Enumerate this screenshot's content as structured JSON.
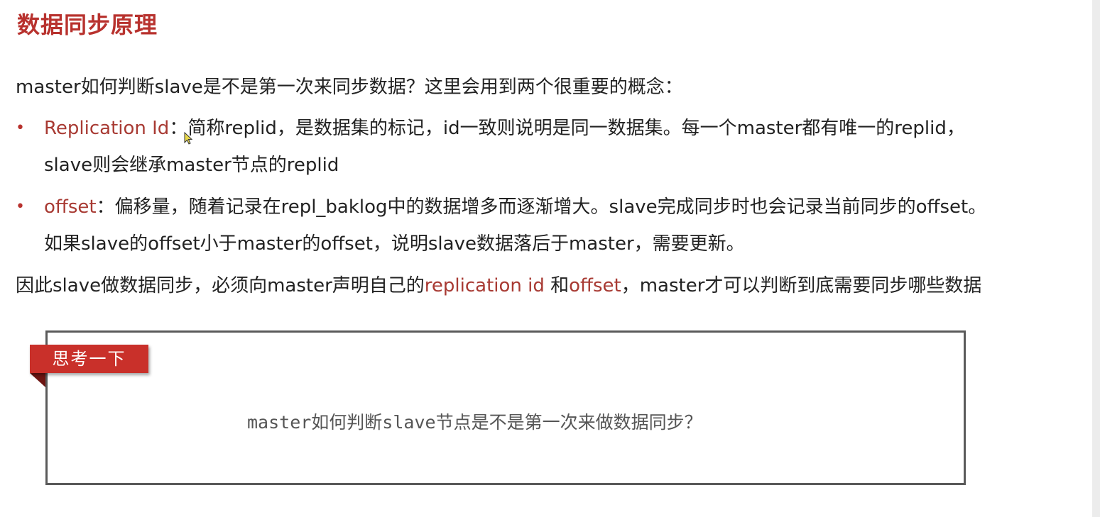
{
  "title": "数据同步原理",
  "intro": "master如何判断slave是不是第一次来同步数据？这里会用到两个很重要的概念：",
  "bullets": [
    {
      "term": "Replication Id",
      "sep": "：",
      "text1": "简称replid，是数据集的标记，id一致则说明是同一数据集。每一个master都有唯一的replid，",
      "text2": "slave则会继承master节点的replid"
    },
    {
      "term": "offset",
      "sep": "：",
      "text1": "偏移量，随着记录在repl_baklog中的数据增多而逐渐增大。slave完成同步时也会记录当前同步的offset。",
      "text2": "如果slave的offset小于master的offset，说明slave数据落后于master，需要更新。"
    }
  ],
  "conclusion": {
    "part1": "因此slave做数据同步，必须向master声明自己的",
    "term1": "replication id",
    "part2": " 和",
    "term2": "offset",
    "part3": "，master才可以判断到底需要同步哪些数据"
  },
  "callout": {
    "tag": "思考一下",
    "question": "master如何判断slave节点是不是第一次来做数据同步？"
  },
  "colors": {
    "accent": "#b8322e",
    "term": "#a83a33",
    "tag_bg": "#c9302a"
  }
}
